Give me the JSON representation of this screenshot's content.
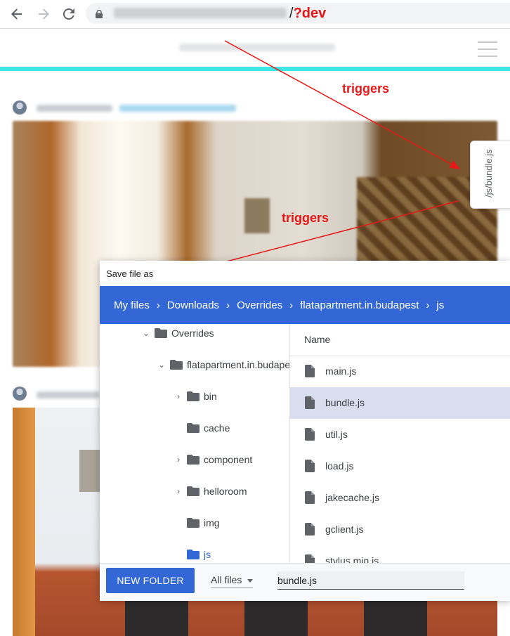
{
  "browser": {
    "url_path_prefix": "/",
    "url_query": "?dev",
    "icons": [
      "back-icon",
      "forward-icon",
      "reload-icon",
      "lock-icon"
    ]
  },
  "site": {
    "side_tab_label": "/js/bundle.js"
  },
  "annotations": {
    "top": "triggers",
    "bottom": "triggers"
  },
  "dialog": {
    "title": "Save file as",
    "breadcrumb": [
      "My files",
      "Downloads",
      "Overrides",
      "flatapartment.in.budapest",
      "js"
    ],
    "tree": [
      {
        "label": "Overrides",
        "expanded": true
      },
      {
        "label": "flatapartment.in.budapest",
        "expanded": true
      },
      {
        "label": "bin",
        "expandable": true
      },
      {
        "label": "cache",
        "expandable": false
      },
      {
        "label": "component",
        "expandable": true
      },
      {
        "label": "helloroom",
        "expandable": true
      },
      {
        "label": "img",
        "expandable": false
      },
      {
        "label": "js",
        "expandable": false,
        "selected": true
      }
    ],
    "list_header": "Name",
    "files": [
      "main.js",
      "bundle.js",
      "util.js",
      "load.js",
      "jakecache.js",
      "gclient.js",
      "stylus.min.js"
    ],
    "selected_file": "bundle.js",
    "new_folder_label": "NEW FOLDER",
    "file_type_filter": "All files",
    "filename_value": "bundle.js"
  },
  "colors": {
    "accent": "#3367d6",
    "annotation": "#e81818",
    "site_stripe": "#3fe8e8"
  }
}
